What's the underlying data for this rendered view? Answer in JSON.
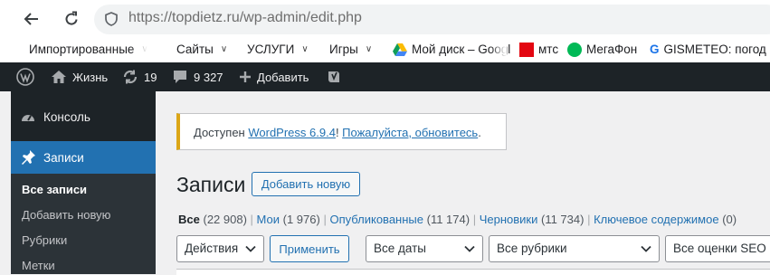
{
  "browser": {
    "url_host": "https://topdietz.ru",
    "url_path": "/wp-admin/edit.php",
    "bookmarks": [
      {
        "label": "Импортированные"
      },
      {
        "label": "Сайты"
      },
      {
        "label": "УСЛУГИ"
      },
      {
        "label": "Игры"
      },
      {
        "label": "Мой диск – Googl"
      },
      {
        "label": "мтс"
      },
      {
        "label": "МегаФон"
      },
      {
        "label": "GISMETEO: погод"
      }
    ],
    "colors": {
      "bar": "#ffffff",
      "urlbar": "#f1f3f4"
    }
  },
  "adminbar": {
    "site_name": "Жизнь",
    "updates_count": "19",
    "comments_count": "9 327",
    "new_label": "Добавить",
    "colors": {
      "bg": "#1d2327"
    }
  },
  "sidebar": {
    "console_label": "Консоль",
    "posts_label": "Записи",
    "submenu": [
      {
        "label": "Все записи",
        "current": true
      },
      {
        "label": "Добавить новую"
      },
      {
        "label": "Рубрики"
      },
      {
        "label": "Метки"
      }
    ],
    "colors": {
      "active": "#2271b1"
    }
  },
  "notice": {
    "prefix": "Доступен ",
    "link1": "WordPress 6.9.4",
    "mid": "! ",
    "link2": "Пожалуйста, обновитесь",
    "suffix": "."
  },
  "main": {
    "title": "Записи",
    "add_new_label": "Добавить новую",
    "filters": [
      {
        "label": "Все",
        "count": "(22 908)"
      },
      {
        "label": "Мои",
        "count": "(1 976)"
      },
      {
        "label": "Опубликованные",
        "count": "(11 174)"
      },
      {
        "label": "Черновики",
        "count": "(11 734)"
      },
      {
        "label": "Ключевое содержимое",
        "count": "(0)"
      }
    ],
    "bulk_action": "Действия",
    "apply_label": "Применить",
    "dates_filter": "Все даты",
    "categories_filter": "Все рубрики",
    "seo_filter": "Все оценки SEO"
  }
}
